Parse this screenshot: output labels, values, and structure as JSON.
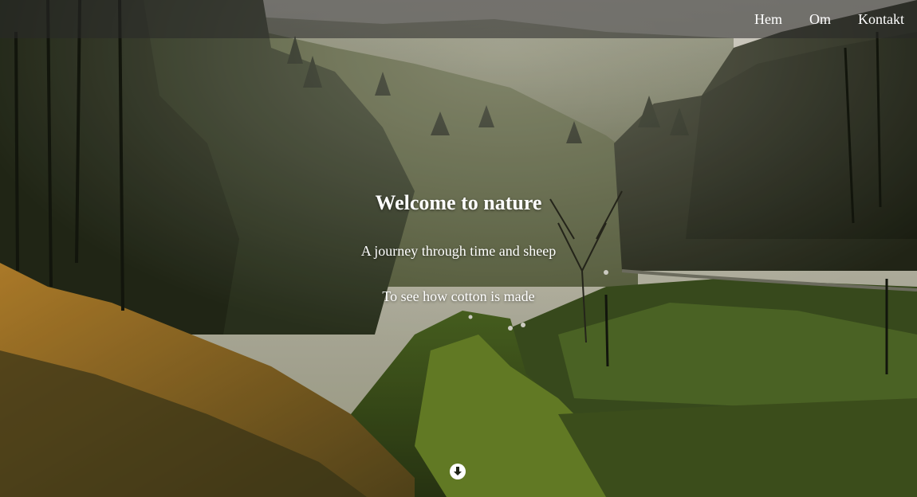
{
  "nav": {
    "items": [
      {
        "label": "Hem"
      },
      {
        "label": "Om"
      },
      {
        "label": "Kontakt"
      }
    ]
  },
  "hero": {
    "title": "Welcome to nature",
    "subtitle": "A journey through time and sheep",
    "subtitle2": "To see how cotton is made",
    "scroll_icon": "arrow-down-circle-icon"
  },
  "colors": {
    "nav_bg": "#282828",
    "text": "#ffffff",
    "forest_dark": "#1f2416",
    "meadow_green": "#6f8a2a",
    "sky": "#d8d4c8",
    "autumn": "#b8862c"
  }
}
